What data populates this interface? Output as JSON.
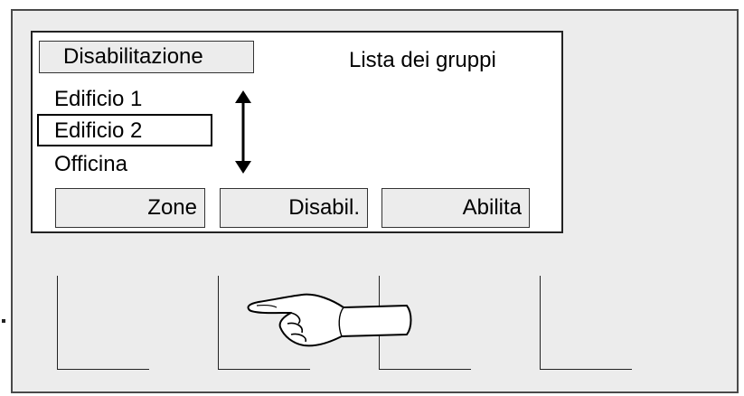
{
  "screen": {
    "mode_button_label": "Disabilitazione",
    "title": "Lista dei gruppi",
    "groups": [
      {
        "label": "Edificio 1",
        "selected": false
      },
      {
        "label": "Edificio 2",
        "selected": true
      },
      {
        "label": "Officina",
        "selected": false
      }
    ],
    "buttons": {
      "zone_label": "Zone",
      "disable_label": "Disabil.",
      "enable_label": "Abilita"
    }
  },
  "icons": {
    "scroll": "up-down-arrow-icon",
    "pointer": "pointing-hand-icon"
  },
  "colors": {
    "panel_background": "#ececec",
    "screen_background": "#ffffff",
    "button_background": "#ececec"
  }
}
